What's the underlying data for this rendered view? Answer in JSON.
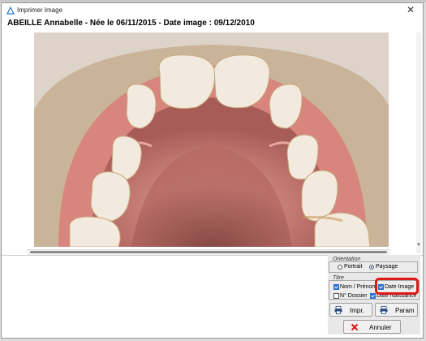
{
  "window": {
    "title": "Imprimer Image"
  },
  "patient_line": "ABEILLE Annabelle - Née le 06/11/2015 - Date image : 09/12/2010",
  "image": {
    "subject": "intraoral-occlusal-photo-upper-arch"
  },
  "orientation": {
    "label": "Orientation",
    "options": [
      {
        "label": "Portrait",
        "selected": false
      },
      {
        "label": "Paysage",
        "selected": true
      }
    ]
  },
  "titre": {
    "label": "Titre",
    "nom_prenom": {
      "label": "Nom / Prénom",
      "checked": true
    },
    "date_image": {
      "label": "Date Image",
      "checked": true
    },
    "no_dossier": {
      "label": "N° Dossier",
      "checked": false
    },
    "date_naissance": {
      "label": "Date Naissance",
      "checked": true
    }
  },
  "buttons": {
    "print": "Impr.",
    "param": "Param",
    "cancel": "Annuler"
  },
  "colors": {
    "highlight": "#e01818",
    "checkbox": "#2a6fd6",
    "cancel_icon": "#d11a1a"
  }
}
